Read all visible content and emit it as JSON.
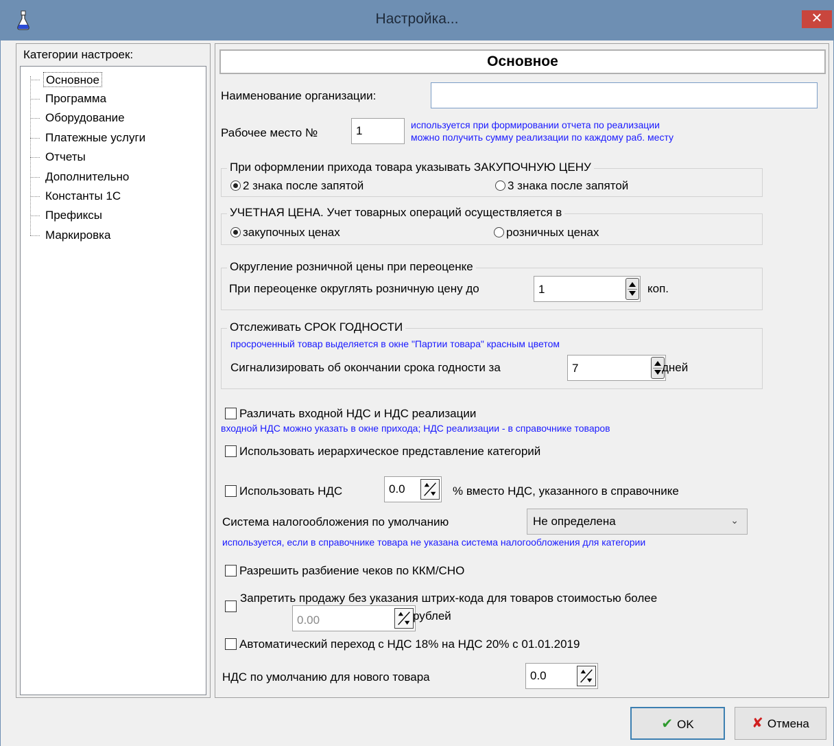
{
  "window": {
    "title": "Настройка...",
    "close_symbol": "✕"
  },
  "sidebar": {
    "caption": "Категории настроек:",
    "items": [
      {
        "label": "Основное",
        "selected": true
      },
      {
        "label": "Программа"
      },
      {
        "label": "Оборудование"
      },
      {
        "label": "Платежные услуги"
      },
      {
        "label": "Отчеты"
      },
      {
        "label": "Дополнительно"
      },
      {
        "label": "Константы 1С"
      },
      {
        "label": "Префиксы"
      },
      {
        "label": "Маркировка"
      }
    ]
  },
  "main": {
    "header": "Основное",
    "org_name": {
      "label": "Наименование организации:",
      "value": ""
    },
    "workplace": {
      "label": "Рабочее место №",
      "value": "1",
      "hint_1": "используется при формировании отчета по реализации",
      "hint_2": "можно получить сумму реализации по каждому раб. месту"
    },
    "purchase_price": {
      "legend": "При оформлении прихода товара указывать ЗАКУПОЧНУЮ ЦЕНУ",
      "option_1": "2 знака после запятой",
      "option_2": "3 знака после запятой",
      "selected": 1
    },
    "accounting_price": {
      "legend": "УЧЕТНАЯ ЦЕНА. Учет товарных операций осуществляется в",
      "option_1": "закупочных ценах",
      "option_2": "розничных ценах",
      "selected": 1
    },
    "rounding": {
      "legend": "Округление розничной цены при переоценке",
      "label": "При переоценке округлять розничную цену до",
      "value": "1",
      "unit": "коп."
    },
    "expiry": {
      "legend": "Отслеживать СРОК ГОДНОСТИ",
      "hint": "просроченный товар выделяется в окне \"Партии товара\" красным цветом",
      "label": "Сигнализировать об окончании срока годности  за",
      "value": "7",
      "unit": "дней"
    },
    "vat_distinguish": {
      "label": "Различать входной НДС и НДС реализации",
      "hint": "входной НДС можно указать в окне прихода; НДС реализации - в справочнике товаров",
      "checked": false
    },
    "hierarchy": {
      "label": "Использовать иерархическое представление категорий",
      "checked": false
    },
    "use_vat": {
      "label": "Использовать НДС",
      "value": "0.0",
      "suffix": "% вместо НДС, указанного в справочнике",
      "checked": false
    },
    "tax_system": {
      "label": "Система налогообложения по умолчанию",
      "value": "Не определена",
      "hint": "используется, если в справочнике товара не указана система налогообложения для категории"
    },
    "split_receipts": {
      "label": "Разрешить разбиение чеков по ККМ/СНО",
      "checked": false
    },
    "barcode_ban": {
      "label": "Запретить продажу без указания штрих-кода для товаров стоимостью более",
      "value": "0.00",
      "unit": "рублей",
      "checked": false
    },
    "auto_vat": {
      "label": "Автоматический переход с НДС 18% на НДС 20% с 01.01.2019",
      "checked": false
    },
    "default_vat": {
      "label": "НДС по умолчанию для нового товара",
      "value": "0.0"
    }
  },
  "footer": {
    "ok_label": "OK",
    "cancel_label": "Отмена"
  },
  "colors": {
    "titlebar": "#6e8fb3",
    "close": "#c9463d",
    "hint": "#1a1aff",
    "ok_check": "#2e9a2e",
    "cancel_x": "#d02020"
  }
}
